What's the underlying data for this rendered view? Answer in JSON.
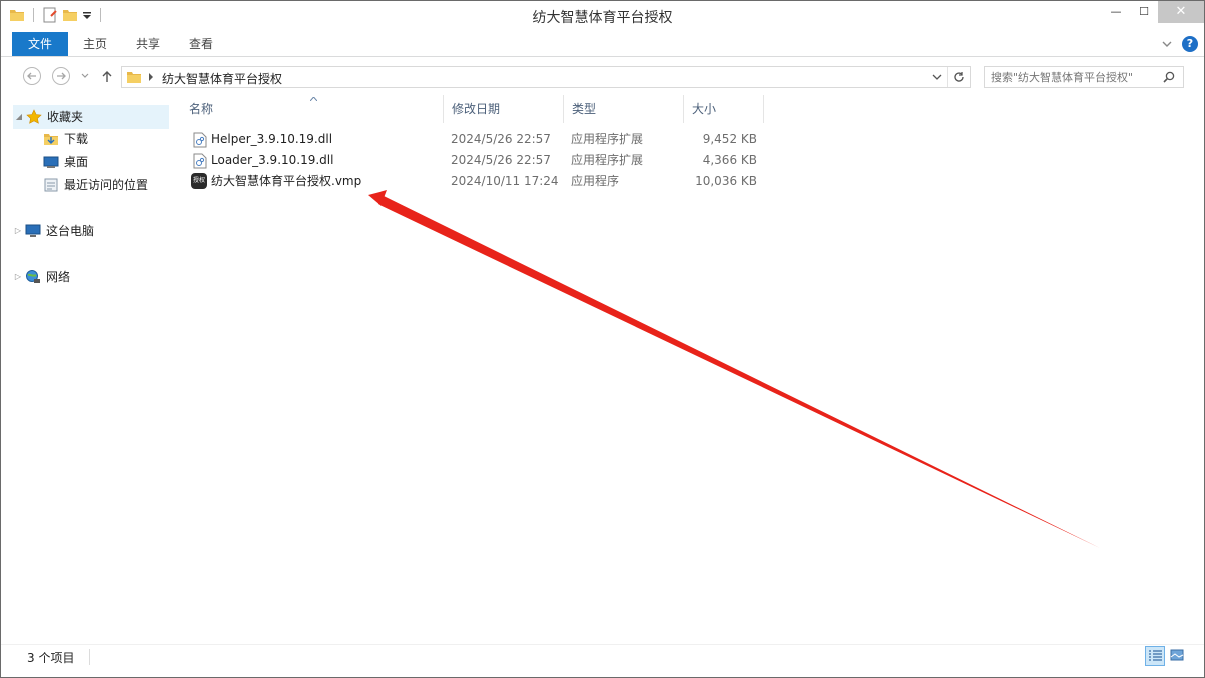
{
  "window": {
    "title": "纺大智慧体育平台授权",
    "minimize_glyph": "—",
    "maximize_glyph": "☐",
    "close_glyph": "✕"
  },
  "ribbon": {
    "tabs": [
      "文件",
      "主页",
      "共享",
      "查看"
    ],
    "help_glyph": "?"
  },
  "address": {
    "path": "纺大智慧体育平台授权",
    "search_placeholder": "搜索\"纺大智慧体育平台授权\""
  },
  "nav_pane": {
    "favorites": "收藏夹",
    "favorites_items": [
      "下载",
      "桌面",
      "最近访问的位置"
    ],
    "this_pc": "这台电脑",
    "network": "网络"
  },
  "columns": [
    "名称",
    "修改日期",
    "类型",
    "大小"
  ],
  "files": [
    {
      "name": "Helper_3.9.10.19.dll",
      "date": "2024/5/26 22:57",
      "type": "应用程序扩展",
      "size": "9,452 KB",
      "icon": "dll-file-icon"
    },
    {
      "name": "Loader_3.9.10.19.dll",
      "date": "2024/5/26 22:57",
      "type": "应用程序扩展",
      "size": "4,366 KB",
      "icon": "dll-file-icon"
    },
    {
      "name": "纺大智慧体育平台授权.vmp",
      "date": "2024/10/11 17:24",
      "type": "应用程序",
      "size": "10,036 KB",
      "icon": "app-file-icon",
      "icon_text": "授权"
    }
  ],
  "status": {
    "item_count": "3 个项目"
  },
  "colors": {
    "accent": "#1979ca",
    "arrow": "#e8231a",
    "column_header": "#4c607a"
  }
}
